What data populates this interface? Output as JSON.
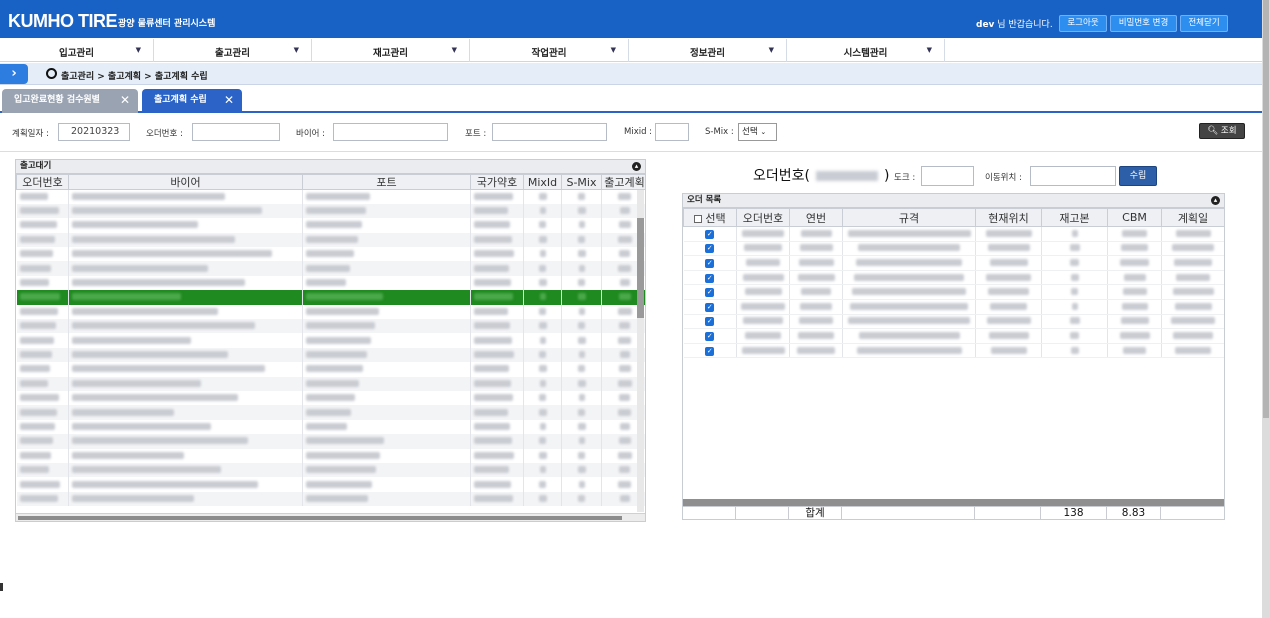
{
  "header": {
    "logo": "KUMHO TIRE",
    "system_title": "광양 물류센터 관리시스템",
    "user": "dev",
    "greeting_suffix": "님 반갑습니다.",
    "buttons": [
      "로그아웃",
      "비밀번호 변경",
      "전체닫기"
    ]
  },
  "menu": [
    "입고관리",
    "출고관리",
    "재고관리",
    "작업관리",
    "정보관리",
    "시스템관리"
  ],
  "breadcrumb": "출고관리 > 출고계획 > 출고계획 수립",
  "tabs": [
    {
      "label": "입고완료현황 검수원별",
      "active": false
    },
    {
      "label": "출고계획 수립",
      "active": true
    }
  ],
  "filter": {
    "plan_date_label": "계획일자 :",
    "plan_date_value": "20210323",
    "order_no_label": "오더번호 :",
    "buyer_label": "바이어 :",
    "port_label": "포트 :",
    "mixid_label": "Mixid :",
    "smix_label": "S-Mix :",
    "smix_selected": "선택",
    "search_button": "조회"
  },
  "left_panel": {
    "title": "출고대기",
    "columns": [
      "오더번호",
      "바이어",
      "포트",
      "국가약호",
      "MixId",
      "S-Mix",
      "출고계획"
    ],
    "row_count": 22,
    "selected_row": 7
  },
  "right_form": {
    "order_title_prefix": "오더번호(",
    "order_title_suffix": ")",
    "dock_label": "도크 :",
    "move_location_label": "이동위치 :",
    "plan_button": "수립"
  },
  "right_panel": {
    "title": "오더 목록",
    "columns": [
      "선택",
      "오더번호",
      "연번",
      "규격",
      "현재위치",
      "재고본",
      "CBM",
      "계획일"
    ],
    "checked_rows": 9,
    "footer": {
      "label": "합계",
      "stock_total": "138",
      "cbm_total": "8.83"
    }
  },
  "colors": {
    "brand": "#1762c4",
    "active_tab": "#2b63c7",
    "inactive_tab": "#9aa3b2",
    "selected_row": "#1f8a1f"
  }
}
